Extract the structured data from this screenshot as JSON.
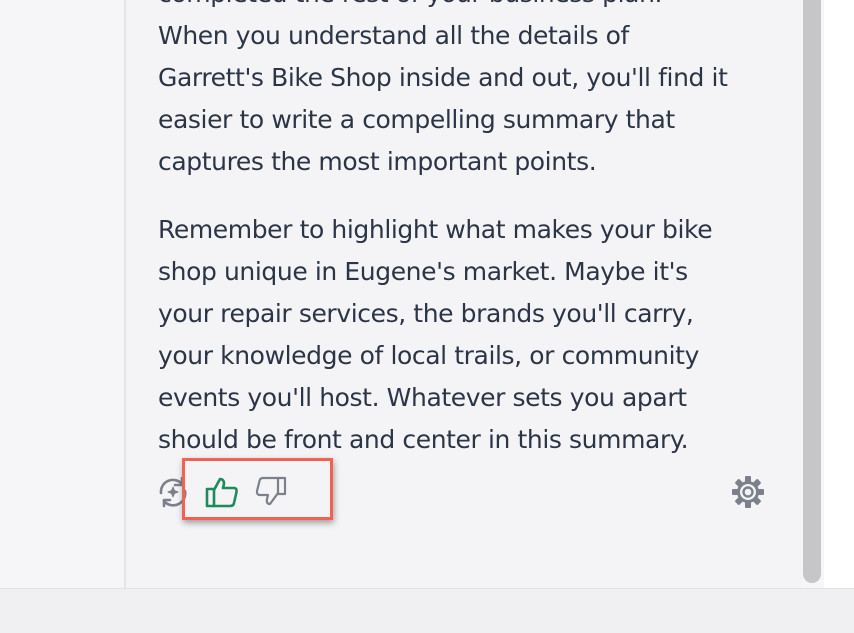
{
  "message": {
    "paragraph1": [
      "completed the rest of your business plan.",
      "When you understand all the details of",
      "Garrett's Bike Shop inside and out, you'll find it",
      "easier to write a compelling summary that",
      "captures the most important points."
    ],
    "paragraph2": [
      "Remember to highlight what makes your bike",
      "shop unique in Eugene's market. Maybe it's",
      "your repair services, the brands you'll carry,",
      "your knowledge of local trails, or community",
      "events you'll host. Whatever sets you apart",
      "should be front and center in this summary."
    ]
  },
  "actions": {
    "regenerate_icon": "refresh-sparkle-icon",
    "thumbs_up_icon": "thumbs-up-icon",
    "thumbs_down_icon": "thumbs-down-icon",
    "settings_icon": "gear-icon"
  },
  "colors": {
    "text": "#2c3546",
    "thumbs_up": "#1f8a5b",
    "icon_gray": "#7b808c",
    "highlight": "#f26252"
  }
}
